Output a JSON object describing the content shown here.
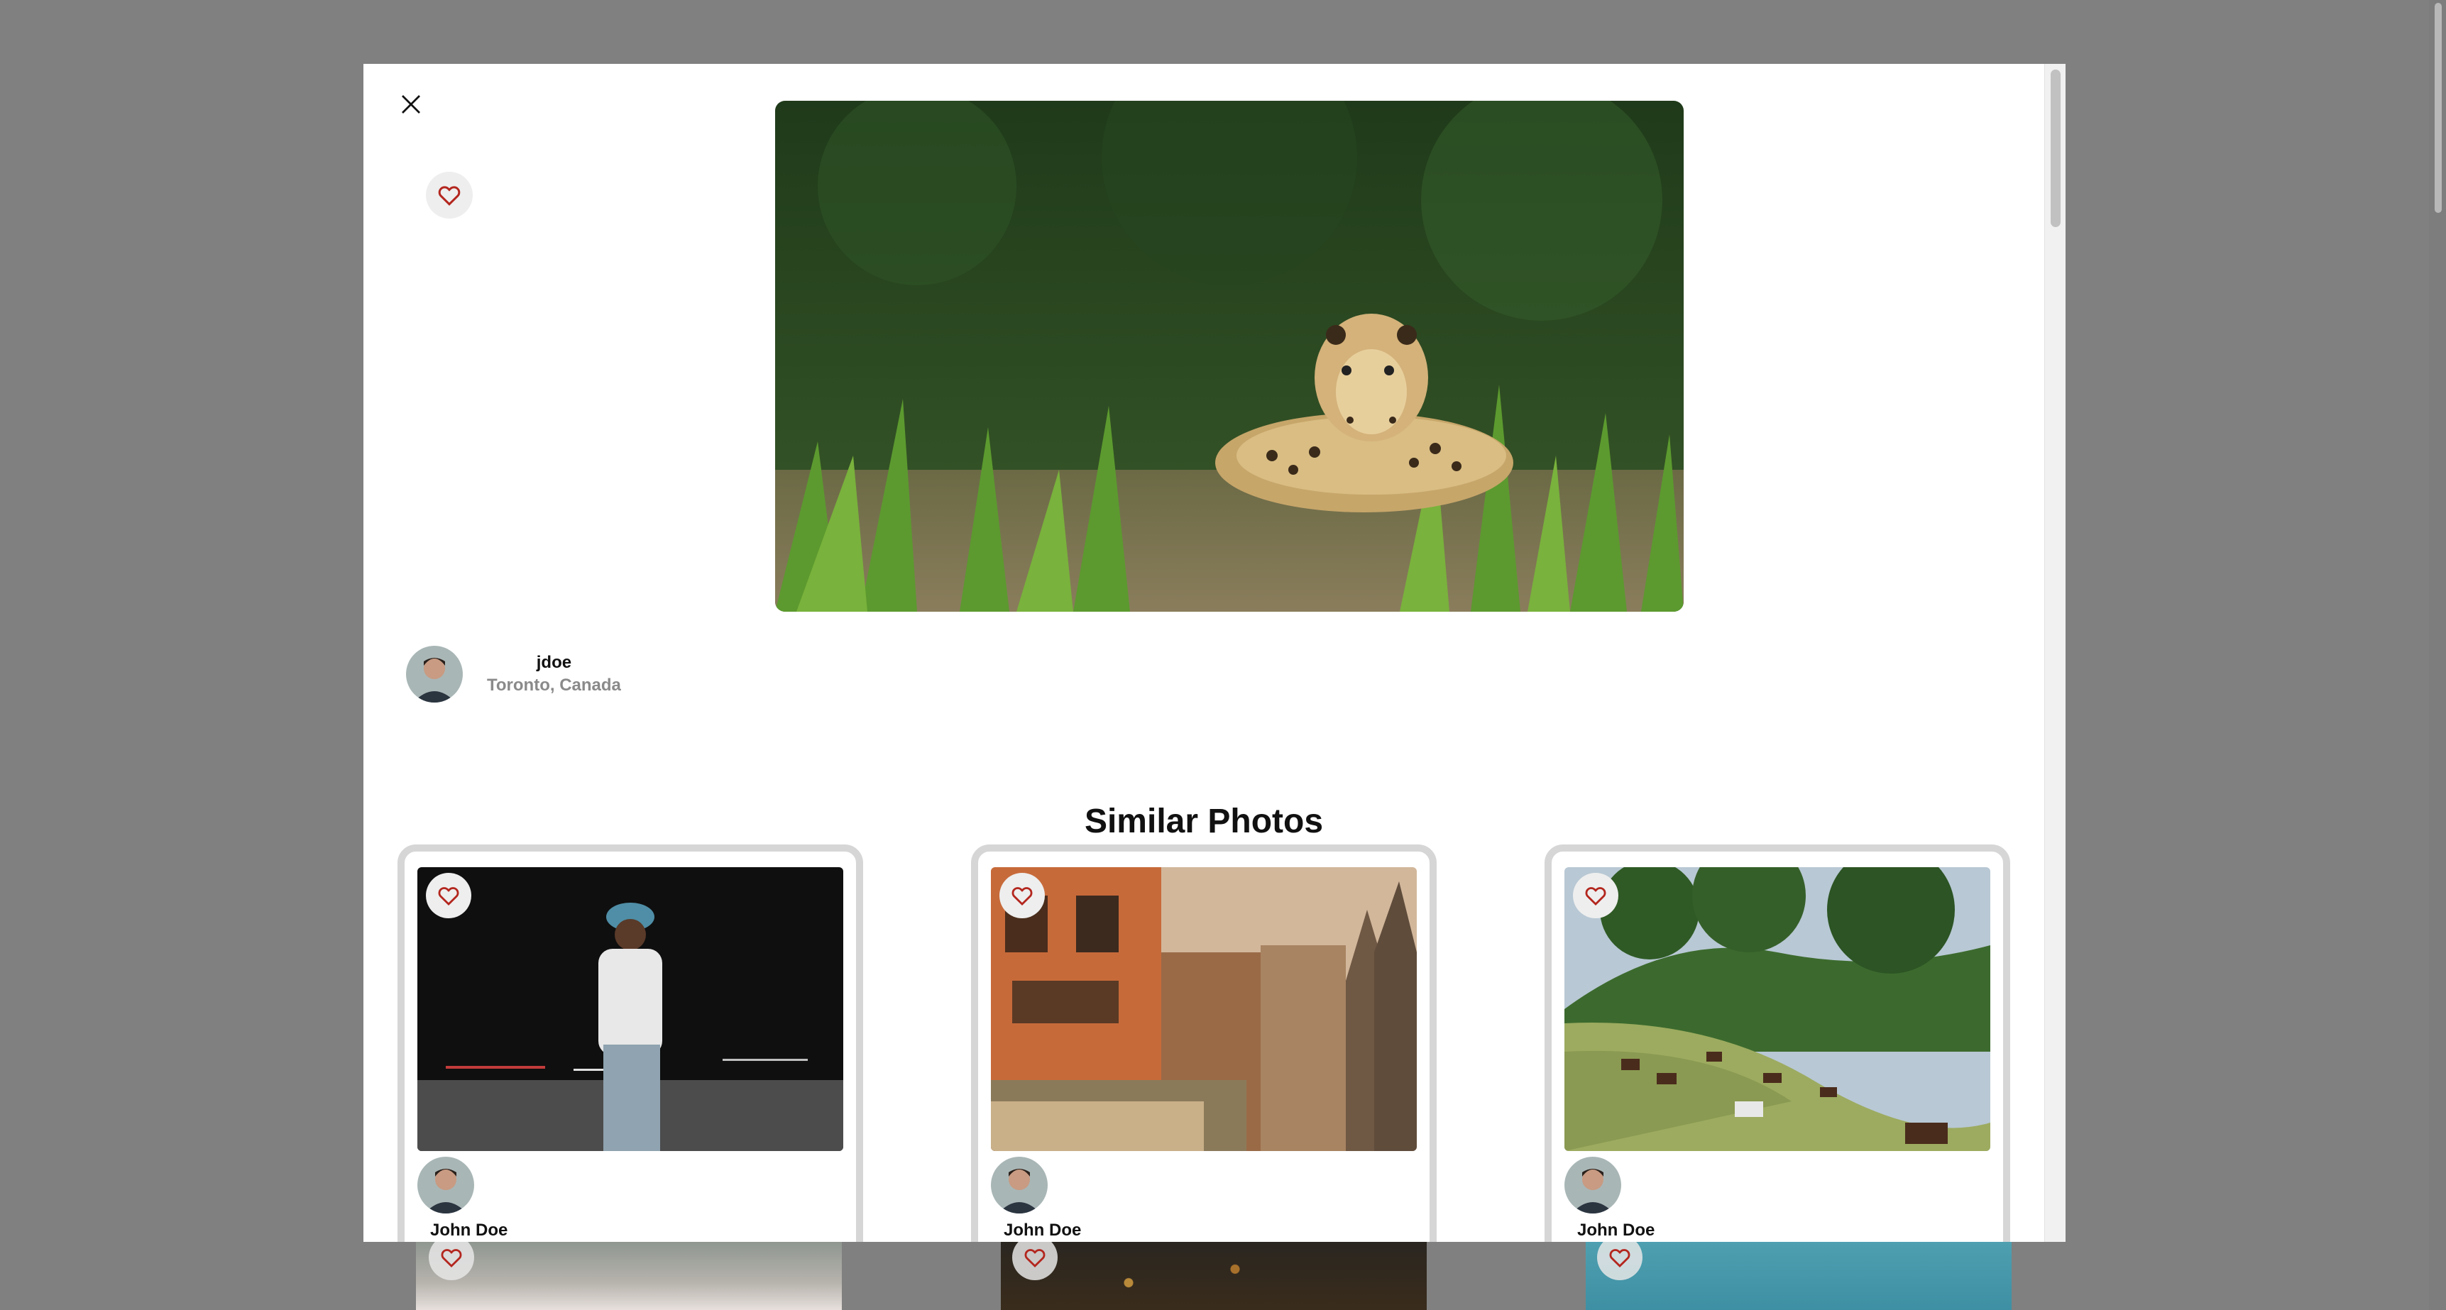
{
  "modal": {
    "close_icon": "close-icon",
    "favorite_icon": "heart-icon",
    "hero_alt": "Jaguar resting in grass"
  },
  "author": {
    "username": "jdoe",
    "location": "Toronto, Canada"
  },
  "similar": {
    "title": "Similar Photos",
    "cards": [
      {
        "name": "John Doe",
        "image": "Man in cap walking at night"
      },
      {
        "name": "John Doe",
        "image": "Old buildings with temple spires"
      },
      {
        "name": "John Doe",
        "image": "Horses grazing on hillside"
      }
    ]
  },
  "colors": {
    "backdrop": "#808080",
    "heart": "#c0392b",
    "card_border": "#d6d6d6"
  }
}
